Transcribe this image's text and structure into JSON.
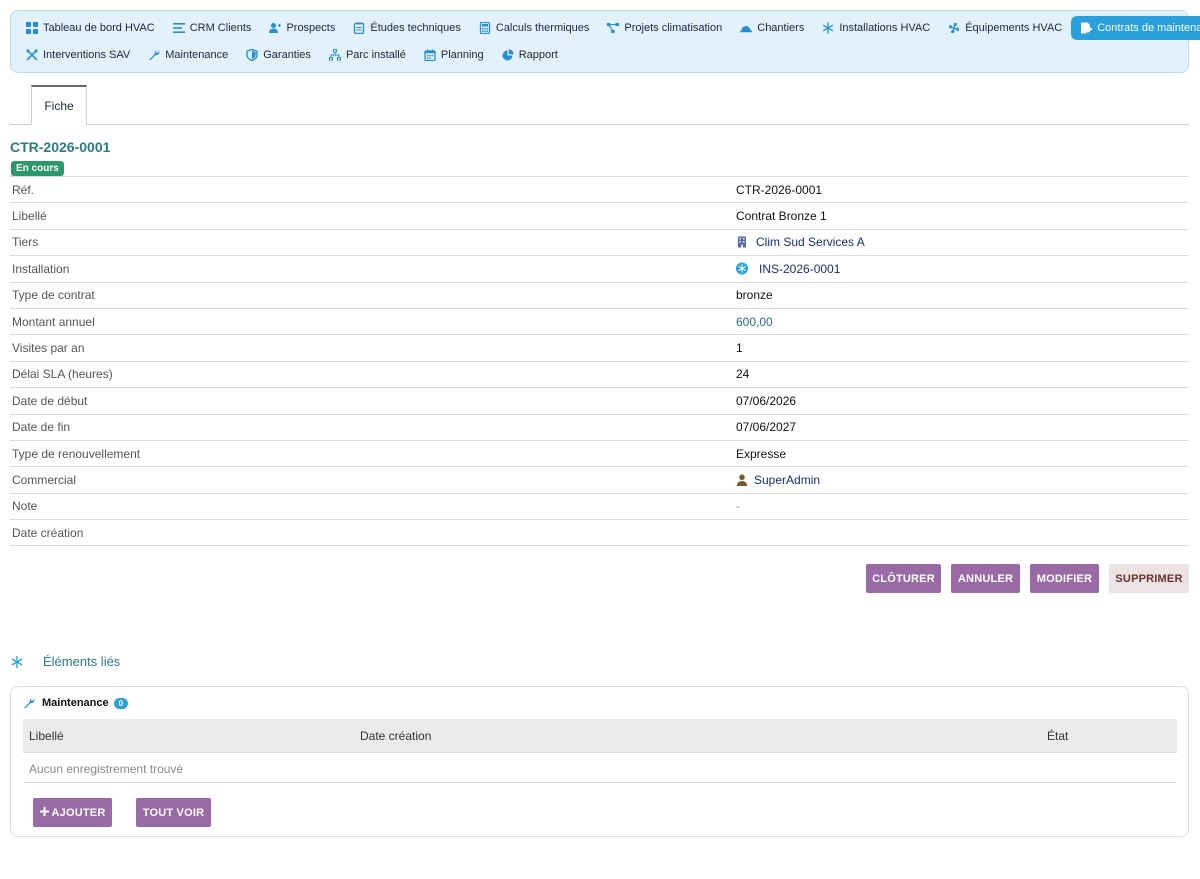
{
  "nav": {
    "row1": [
      {
        "label": "Tableau de bord HVAC",
        "icon": "dashboard-icon"
      },
      {
        "label": "CRM Clients",
        "icon": "list-icon"
      },
      {
        "label": "Prospects",
        "icon": "user-plus-icon"
      },
      {
        "label": "Études techniques",
        "icon": "clipboard-icon"
      },
      {
        "label": "Calculs thermiques",
        "icon": "calculator-icon"
      },
      {
        "label": "Projets climatisation",
        "icon": "project-diagram-icon"
      },
      {
        "label": "Chantiers",
        "icon": "hard-hat-icon"
      },
      {
        "label": "Installations HVAC",
        "icon": "snowflake-icon"
      },
      {
        "label": "Équipements HVAC",
        "icon": "fan-icon"
      },
      {
        "label": "Contrats de maintenance",
        "icon": "contract-icon",
        "active": true
      }
    ],
    "row2": [
      {
        "label": "Interventions SAV",
        "icon": "tools-icon"
      },
      {
        "label": "Maintenance",
        "icon": "wrench-icon"
      },
      {
        "label": "Garanties",
        "icon": "shield-icon"
      },
      {
        "label": "Parc installé",
        "icon": "sitemap-icon"
      },
      {
        "label": "Planning",
        "icon": "calendar-icon"
      },
      {
        "label": "Rapport",
        "icon": "pie-chart-icon"
      }
    ]
  },
  "tabs": {
    "fiche": "Fiche"
  },
  "record": {
    "title": "CTR-2026-0001",
    "status": "En cours"
  },
  "fields": [
    {
      "label": "Réf.",
      "value": "CTR-2026-0001",
      "kind": "text"
    },
    {
      "label": "Libellé",
      "value": "Contrat Bronze 1",
      "kind": "text"
    },
    {
      "label": "Tiers",
      "value": "Clim Sud Services A",
      "kind": "link",
      "icon": "building-icon"
    },
    {
      "label": "Installation",
      "value": "INS-2026-0001",
      "kind": "link",
      "icon": "snowflake-icon"
    },
    {
      "label": "Type de contrat",
      "value": "bronze",
      "kind": "text"
    },
    {
      "label": "Montant annuel",
      "value": "600,00",
      "kind": "num"
    },
    {
      "label": "Visites par an",
      "value": "1",
      "kind": "text"
    },
    {
      "label": "Délai SLA (heures)",
      "value": "24",
      "kind": "text"
    },
    {
      "label": "Date de début",
      "value": "07/06/2026",
      "kind": "text"
    },
    {
      "label": "Date de fin",
      "value": "07/06/2027",
      "kind": "text"
    },
    {
      "label": "Type de renouvellement",
      "value": "Expresse",
      "kind": "text"
    },
    {
      "label": "Commercial",
      "value": "SuperAdmin",
      "kind": "link",
      "icon": "user-icon"
    },
    {
      "label": "Note",
      "value": "-",
      "kind": "muted"
    },
    {
      "label": "Date création",
      "value": "",
      "kind": "text"
    }
  ],
  "actions": {
    "cloturer": "CLÔTURER",
    "annuler": "ANNULER",
    "modifier": "MODIFIER",
    "supprimer": "SUPPRIMER"
  },
  "linked": {
    "heading": "Éléments liés",
    "panel_title": "Maintenance",
    "count": "0",
    "columns": [
      "Libellé",
      "Date création",
      "État"
    ],
    "empty_text": "Aucun enregistrement trouvé",
    "add_label": "AJOUTER",
    "see_all_label": "TOUT VOIR"
  },
  "colors": {
    "accent": "#29a0dc",
    "title": "#2a7d84",
    "button": "#9a6aa6",
    "status_badge": "#2a9a6a"
  }
}
